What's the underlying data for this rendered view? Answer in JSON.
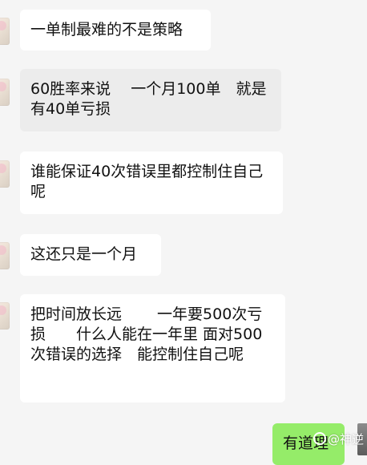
{
  "messages": [
    {
      "text": "一单制最难的不是策略",
      "side": "left"
    },
    {
      "text": "60胜率来说　 一个月100单　就是有40单亏损",
      "side": "left"
    },
    {
      "text": "谁能保证40次错误里都控制住自己呢",
      "side": "left"
    },
    {
      "text": "这还只是一个月",
      "side": "left"
    },
    {
      "text": "把时间放长远　　 一年要500次亏损　　什么人能在一年里 面对500次错误的选择　能控制住自己呢",
      "side": "left"
    },
    {
      "text": "有道理",
      "side": "right"
    }
  ],
  "watermark": "@神逆",
  "colors": {
    "background": "#f5f5f5",
    "incoming": "#ffffff",
    "outgoing": "#95ec69"
  }
}
